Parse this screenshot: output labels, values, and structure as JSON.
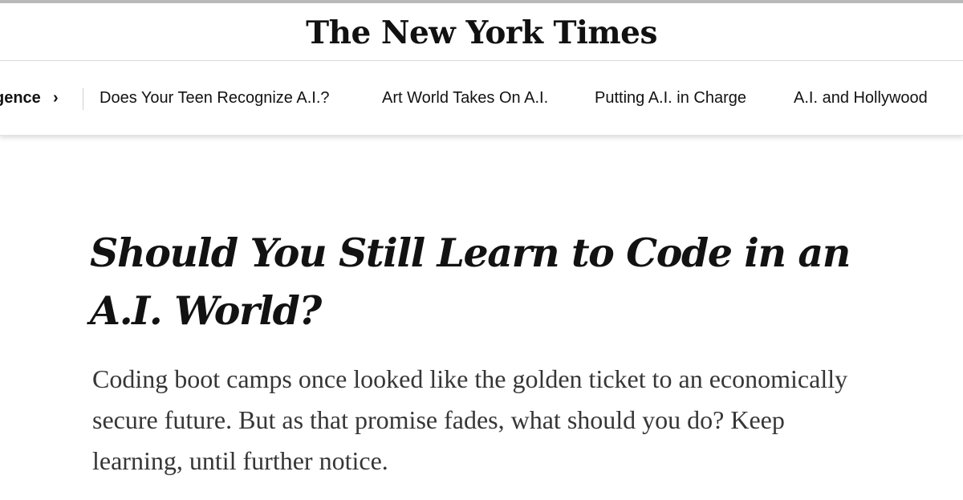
{
  "masthead": {
    "logo_text": "The New York Times"
  },
  "subnav": {
    "section_label": "gence",
    "section_chevron": "›",
    "links": [
      "Does Your Teen Recognize A.I.?",
      "Art World Takes On A.I.",
      "Putting A.I. in Charge",
      "A.I. and Hollywood"
    ]
  },
  "article": {
    "headline": "Should You Still Learn to Code in an A.I. World?",
    "summary": "Coding boot camps once looked like the golden ticket to an economically secure future. But as that promise fades, what should you do? Keep learning, until further notice."
  }
}
